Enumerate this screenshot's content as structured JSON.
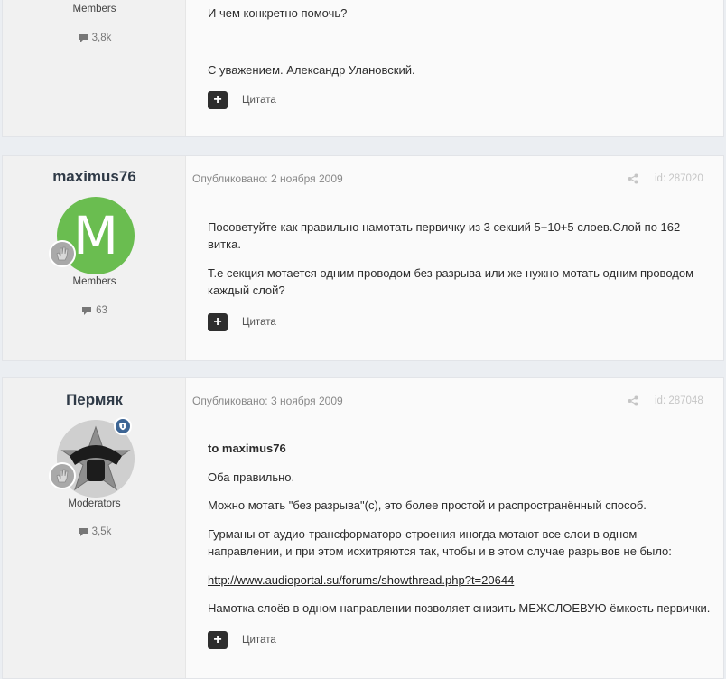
{
  "posts": [
    {
      "group": "Members",
      "reputation": "3,8k",
      "body": [
        "И чем конкретно помочь?",
        "С уважением. Александр Улановский."
      ],
      "quote_label": "Цитата"
    },
    {
      "author": "maximus76",
      "avatar_letter": "M",
      "group": "Members",
      "reputation": "63",
      "published": "Опубликовано: 2 ноября 2009",
      "post_id": "id: 287020",
      "body": [
        "Посоветуйте как правильно намотать первичку из 3 секций 5+10+5 слоев.Слой по 162 витка.",
        "Т.е секция мотается одним проводом без разрыва или же нужно мотать одним проводом каждый слой?"
      ],
      "quote_label": "Цитата"
    },
    {
      "author": "Пермяк",
      "group": "Moderators",
      "reputation": "3,5k",
      "published": "Опубликовано: 3 ноября 2009",
      "post_id": "id: 287048",
      "body": [
        "to maximus76",
        "Оба правильно.",
        "Можно мотать \"без разрыва\"(с), это более простой и распространённый способ.",
        "Гурманы от аудио-трансформаторо-строения иногда мотают все слои в одном направлении, и при этом исхитряются так, чтобы и в этом случае разрывов не было:",
        "http://www.audioportal.su/forums/showthread.php?t=20644",
        "Намотка слоёв в одном направлении позволяет снизить МЕЖСЛОЕВУЮ ёмкость первички."
      ],
      "quote_label": "Цитата"
    }
  ],
  "colors": {
    "page_bg": "#ebeef2",
    "author_bg": "#f1f1f1",
    "avatar_green": "#6abd50",
    "moderator_badge": "#3d6594",
    "quote_button": "#2e2e2e"
  },
  "icons": {
    "reputation": "comment-icon",
    "share": "share-icon",
    "rank": "rank-hand-icon",
    "moderator": "shield-icon",
    "quote": "plus-icon"
  }
}
